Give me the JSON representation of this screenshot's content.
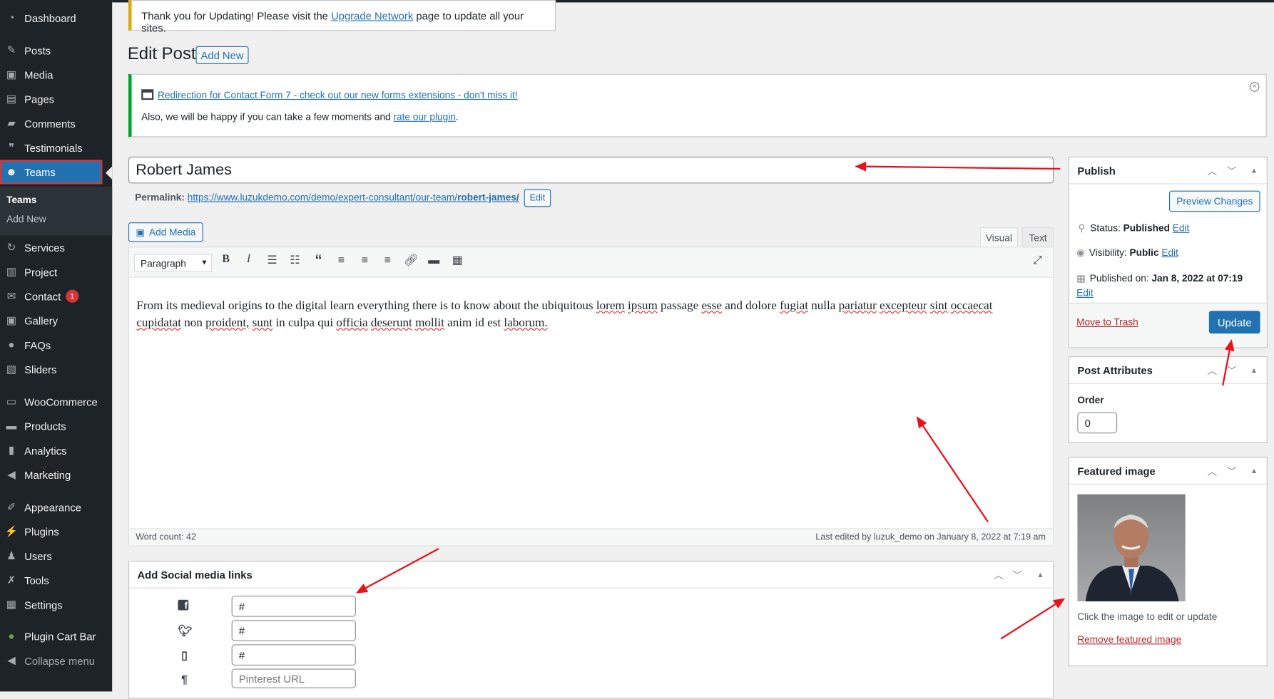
{
  "sidebar": {
    "items": [
      {
        "label": "Dashboard",
        "icon": "dashboard-icon"
      },
      {
        "label": "Posts",
        "icon": "pin-icon"
      },
      {
        "label": "Media",
        "icon": "media-icon"
      },
      {
        "label": "Pages",
        "icon": "pages-icon"
      },
      {
        "label": "Comments",
        "icon": "comment-icon"
      },
      {
        "label": "Testimonials",
        "icon": "testimonial-icon"
      },
      {
        "label": "Teams",
        "icon": "groups-icon"
      },
      {
        "label": "Services",
        "icon": "services-icon"
      },
      {
        "label": "Project",
        "icon": "project-icon"
      },
      {
        "label": "Contact",
        "icon": "mail-icon",
        "badge": "1"
      },
      {
        "label": "Gallery",
        "icon": "gallery-icon"
      },
      {
        "label": "FAQs",
        "icon": "faq-icon"
      },
      {
        "label": "Sliders",
        "icon": "slider-icon"
      },
      {
        "label": "WooCommerce",
        "icon": "woo-icon"
      },
      {
        "label": "Products",
        "icon": "archive-icon"
      },
      {
        "label": "Analytics",
        "icon": "chart-icon"
      },
      {
        "label": "Marketing",
        "icon": "megaphone-icon"
      },
      {
        "label": "Appearance",
        "icon": "brush-icon"
      },
      {
        "label": "Plugins",
        "icon": "plugin-icon"
      },
      {
        "label": "Users",
        "icon": "user-icon"
      },
      {
        "label": "Tools",
        "icon": "wrench-icon"
      },
      {
        "label": "Settings",
        "icon": "settings-icon"
      },
      {
        "label": "Plugin Cart Bar",
        "icon": "leaf-icon"
      },
      {
        "label": "Collapse menu",
        "icon": "collapse-icon"
      }
    ],
    "submenu": [
      "Teams",
      "Add New"
    ],
    "accent": "#2271b1"
  },
  "update_notice": {
    "before": "Thank you for Updating! Please visit the ",
    "link": "Upgrade Network",
    "after": " page to update all your sites."
  },
  "page": {
    "title": "Edit Post",
    "add_new": "Add New"
  },
  "plugin_notice": {
    "link": "Redirection for Contact Form 7 - check out our new forms extensions - don't miss it!",
    "line2_before": "Also, we will be happy if you can take a few moments and ",
    "line2_link": "rate our plugin",
    "line2_after": "."
  },
  "post": {
    "title": "Robert James",
    "permalink_label": "Permalink:",
    "permalink_base": "https://www.luzukdemo.com/demo/expert-consultant/our-team/",
    "permalink_slug": "robert-james/",
    "edit": "Edit"
  },
  "editor": {
    "add_media": "Add Media",
    "tab_visual": "Visual",
    "tab_text": "Text",
    "format": "Paragraph",
    "content": "From its medieval origins to the digital learn everything there is to know about the ubiquitous lorem ipsum passage esse and dolore fugiat nulla pariatur excepteur sint occaecat cupidatat non proident, sunt in culpa qui officia deserunt mollit anim id est laborum.",
    "word_count": "Word count: 42",
    "last_edited": "Last edited by luzuk_demo on January 8, 2022 at 7:19 am"
  },
  "social": {
    "title": "Add Social media links",
    "fields": [
      {
        "icon": "facebook-icon",
        "value": "#"
      },
      {
        "icon": "twitter-icon",
        "value": "#"
      },
      {
        "icon": "phone-icon",
        "value": "#"
      },
      {
        "icon": "pinterest-icon",
        "value": "",
        "placeholder": "Pinterest URL"
      }
    ]
  },
  "publish": {
    "title": "Publish",
    "preview": "Preview Changes",
    "status_label": "Status:",
    "status": "Published",
    "visibility_label": "Visibility:",
    "visibility": "Public",
    "published_label": "Published on:",
    "published": "Jan 8, 2022 at 07:19",
    "edit": "Edit",
    "trash": "Move to Trash",
    "update": "Update"
  },
  "attributes": {
    "title": "Post Attributes",
    "order_label": "Order",
    "order": "0"
  },
  "featured": {
    "title": "Featured image",
    "hint": "Click the image to edit or update",
    "remove": "Remove featured image"
  },
  "annotation_color": "#e8121b"
}
